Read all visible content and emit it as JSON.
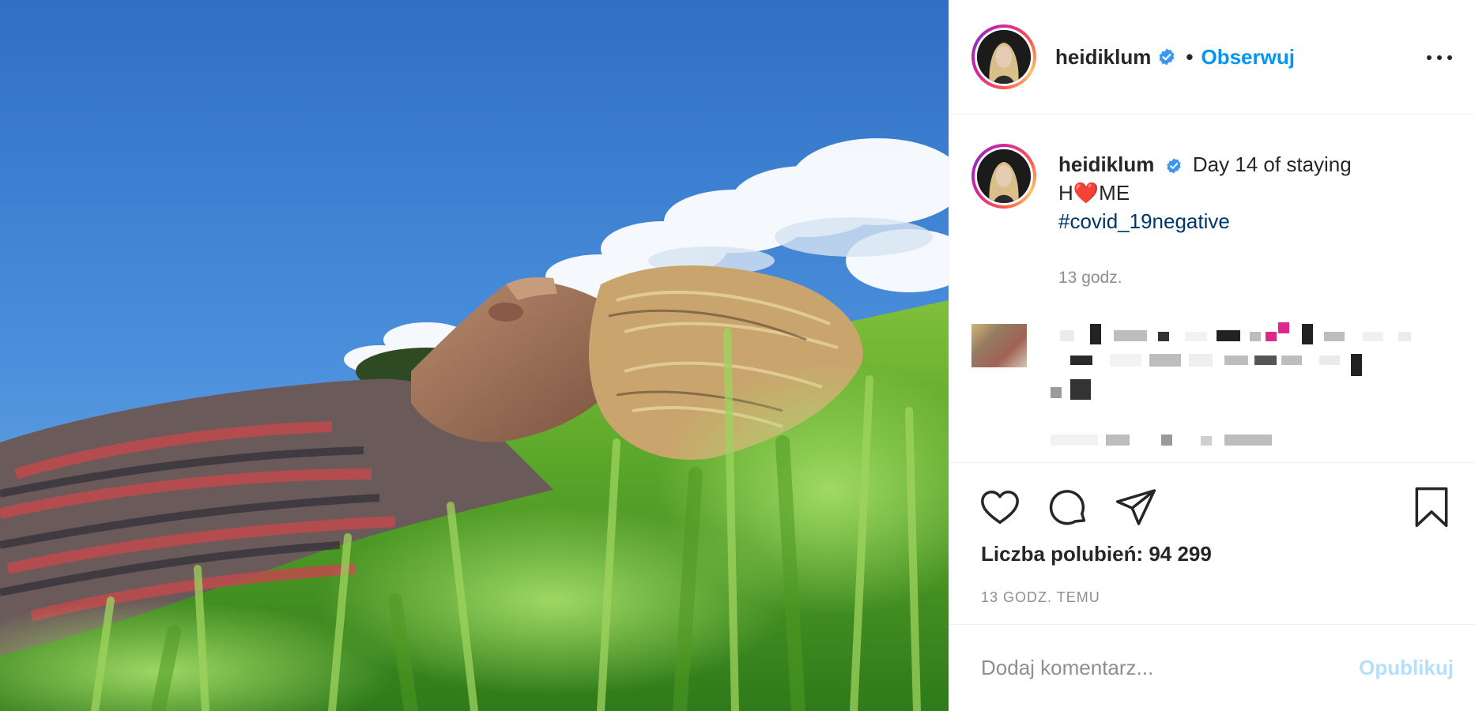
{
  "post": {
    "image_alt": "Woman lying on grass under a blue sky",
    "author": {
      "username": "heidiklum",
      "verified": true,
      "avatar_icon": "profile-avatar-icon",
      "verified_icon": "verified-badge-icon"
    },
    "header": {
      "separator": "•",
      "follow_label": "Obserwuj",
      "more_icon": "more-options-icon"
    },
    "caption": {
      "username": "heidiklum",
      "text_line1": "Day 14 of staying",
      "text_h": "H",
      "text_heart": "❤️",
      "text_me": "ME",
      "hashtag": "#covid_19negative",
      "time": "13 godz."
    },
    "actions": {
      "like_icon": "heart-icon",
      "comment_icon": "comment-icon",
      "share_icon": "share-icon",
      "save_icon": "bookmark-icon"
    },
    "likes_label": "Liczba polubień: 94 299",
    "posted_ago": "13 godz. temu",
    "comment_input": {
      "placeholder": "Dodaj komentarz...",
      "publish_label": "Opublikuj"
    },
    "colors": {
      "accent": "#0095f6",
      "hashtag": "#00376b",
      "muted": "#8e8e8e",
      "publish_disabled": "#b2dffc",
      "heart": "#e0245e"
    }
  }
}
